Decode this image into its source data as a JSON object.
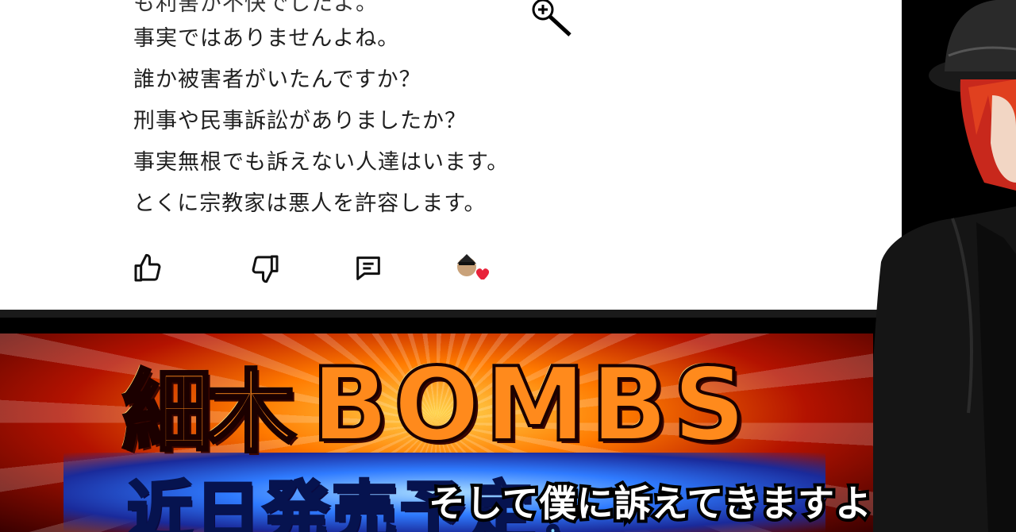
{
  "comment": {
    "partial_top_line": "も利害が不快でしたよ。",
    "lines": [
      "事実ではありませんよね。",
      "誰か被害者がいたんですか？",
      "刑事や民事訴訟がありましたか？",
      "事実無根でも訴えない人達はいます。",
      "とくに宗教家は悪人を許容します。"
    ]
  },
  "actions": {
    "like_icon": "thumbs-up-icon",
    "dislike_icon": "thumbs-down-icon",
    "reply_icon": "comment-icon",
    "creator_heart_icon": "creator-heart-icon",
    "heart_color": "#e8223a"
  },
  "banner": {
    "title_kanji": "細木",
    "title_en": "BOMBS",
    "subtitle": "近日発売予定！"
  },
  "subtitle_caption": "そして僕に訴えてきますよ"
}
